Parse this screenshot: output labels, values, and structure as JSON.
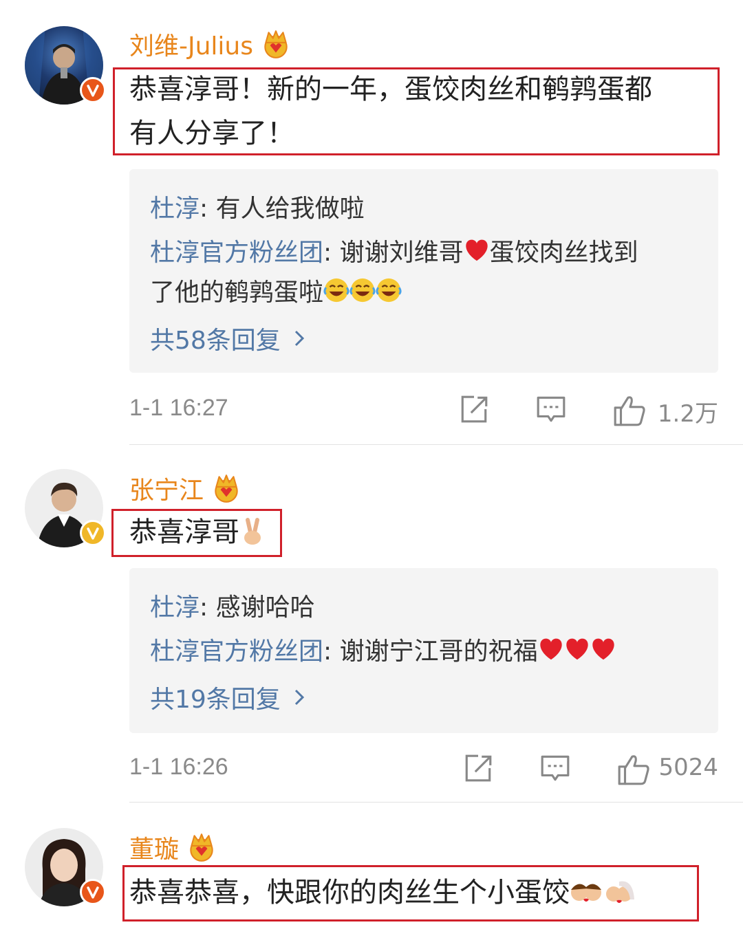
{
  "comments": [
    {
      "username": "刘维-Julius",
      "text_lines": [
        "恭喜淳哥！新的一年，蛋饺肉丝和鹌鹑蛋都",
        "有人分享了！"
      ],
      "replies": [
        {
          "name": "杜淳",
          "text": ": 有人给我做啦"
        },
        {
          "name": "杜淳官方粉丝团",
          "text": ": 谢谢刘维哥",
          "text2": "蛋饺肉丝找到",
          "cont": "了他的鹌鹑蛋啦"
        }
      ],
      "more_replies": "共58条回复",
      "time": "1-1 16:27",
      "likes": "1.2万"
    },
    {
      "username": "张宁江",
      "text_lines": [
        "恭喜淳哥"
      ],
      "replies": [
        {
          "name": "杜淳",
          "text": ": 感谢哈哈"
        },
        {
          "name": "杜淳官方粉丝团",
          "text": ": 谢谢宁江哥的祝福"
        }
      ],
      "more_replies": "共19条回复",
      "time": "1-1 16:26",
      "likes": "5024"
    },
    {
      "username": "董璇",
      "text_lines": [
        "恭喜恭喜，快跟你的肉丝生个小蛋饺"
      ]
    }
  ],
  "icons": {
    "crown": "crown-icon",
    "verified": "verified-v-icon",
    "share": "share-icon",
    "comment": "comment-icon",
    "like": "thumbs-up-icon"
  },
  "colors": {
    "username": "#e8861c",
    "reply_name": "#5278a6",
    "highlight_box": "#d0202a",
    "reply_bg": "#f4f4f4",
    "meta_text": "#8a8a8a"
  }
}
